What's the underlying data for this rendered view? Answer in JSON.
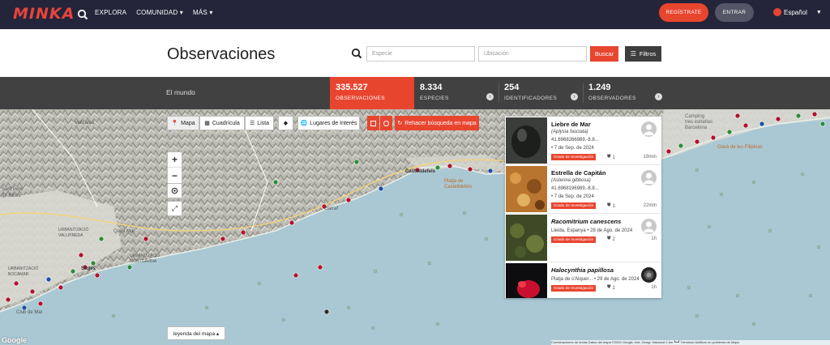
{
  "nav": {
    "logo": "MINKA",
    "links": [
      "EXPLORA",
      "COMUNIDAD ▾",
      "MÁS ▾"
    ],
    "register": "REGÍSTRATE",
    "login": "ENTRAR",
    "language": "Español"
  },
  "header": {
    "title": "Observaciones",
    "species_placeholder": "Especie",
    "location_placeholder": "Ubicación",
    "search_button": "Buscar",
    "filters_button": "Filtros"
  },
  "stats": {
    "region": "El mundo",
    "items": [
      {
        "value": "335.527",
        "label": "OBSERVACIONES"
      },
      {
        "value": "8.334",
        "label": "ESPECIES"
      },
      {
        "value": "254",
        "label": "IDENTIFICADORES"
      },
      {
        "value": "1.249",
        "label": "OBSERVADORES"
      }
    ]
  },
  "map": {
    "view_buttons": [
      "Mapa",
      "Cuadrícula",
      "Lista"
    ],
    "places_button": "Lugares de Interés",
    "redo_button": "Rehacer búsqueda en mapa",
    "zoom_in": "+",
    "zoom_out": "−",
    "legend_button": "leyenda del mapa ▴",
    "google": "Google",
    "attribution": "Combinaciones de teclas    Datos del mapa ©2024 Google, Inst. Geogr. Nacional    1 km ┗━┛    Términos    Notificar un problema de Maps",
    "place_labels": [
      "Sant Pere de Ribes",
      "URBANITZACIÓ VALLPINEDA",
      "URBANITZACIÓ BOCAMAR",
      "URBANITZACIÓ MONTGAVINA",
      "Quint Mar",
      "Sitges",
      "Castelldefels",
      "Barcelona",
      "Camping tres estrellas Barcelona",
      "Gavà de les Filipinas",
      "Garraf",
      "Club de Mar",
      "Vallcarca",
      "Platja de Castelldefels"
    ]
  },
  "observations": [
    {
      "common": "Liebre de Mar",
      "scientific": "(Aplysia fasciata)",
      "location": "41.6968266989,-8.8...",
      "date": "• 7 de Sep. de 2024",
      "grade": "Grado de Investigación",
      "ids": "1",
      "time": "19min"
    },
    {
      "common": "Estrella de Capitán",
      "scientific": "(Asterina gibbosa)",
      "location": "41.6968196989,-8.8...",
      "date": "• 7 de Sep. de 2024",
      "grade": "Grado de Investigación",
      "ids": "1",
      "time": "22min"
    },
    {
      "common": "Racomitrium canescens",
      "scientific": "",
      "location": "Lleida, Espanya • 28 de Ago. de 2024",
      "date": "",
      "grade": "Grado de Investigación",
      "ids": "2",
      "time": "1h"
    },
    {
      "common": "Halocynthia papillosa",
      "scientific": "",
      "location": "Platja de s'Alquer... • 29 de Ago. de 2024",
      "date": "",
      "grade": "Grado de Investigación",
      "ids": "1",
      "time": "1h"
    }
  ],
  "colors": {
    "accent": "#e8452f",
    "nav": "#24253a",
    "stats": "#414141"
  }
}
